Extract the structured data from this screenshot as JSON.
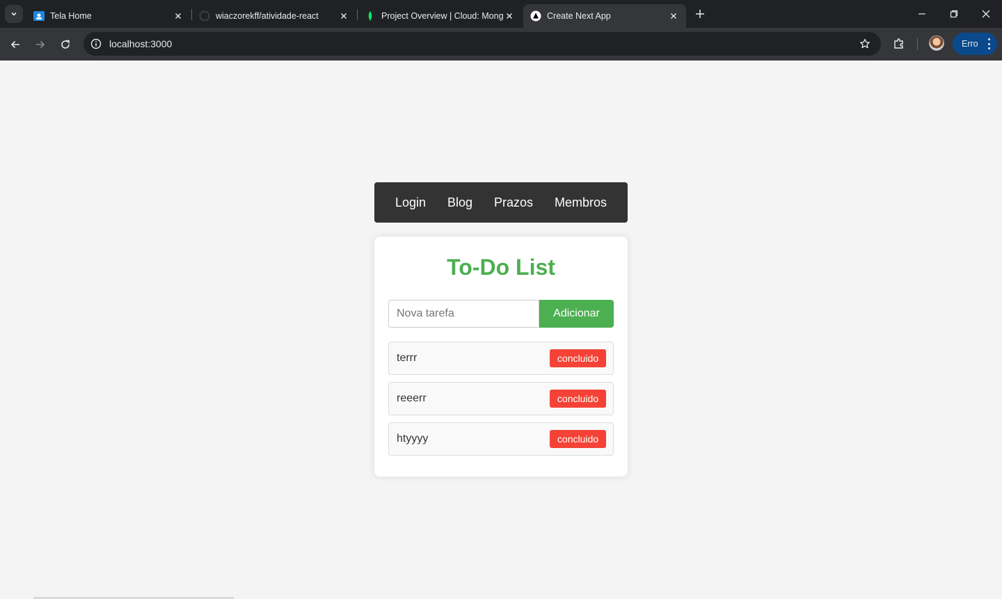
{
  "browser": {
    "tabs": [
      {
        "title": "Tela Home",
        "icon": "google-classroom-icon",
        "active": false
      },
      {
        "title": "wiaczorekff/atividade-react",
        "icon": "github-icon",
        "active": false
      },
      {
        "title": "Project Overview | Cloud: MongoDB Cloud",
        "icon": "mongodb-leaf-icon",
        "active": false
      },
      {
        "title": "Create Next App",
        "icon": "nextjs-triangle-icon",
        "active": true
      }
    ],
    "url": "localhost:3000",
    "profile_button_label": "Erro"
  },
  "nav": {
    "links": [
      "Login",
      "Blog",
      "Prazos",
      "Membros"
    ]
  },
  "todo": {
    "title": "To-Do List",
    "input_placeholder": "Nova tarefa",
    "input_value": "",
    "add_button_label": "Adicionar",
    "tasks": [
      {
        "text": "terrr",
        "button_label": "concluido"
      },
      {
        "text": "reeerr",
        "button_label": "concluido"
      },
      {
        "text": "htyyyy",
        "button_label": "concluido"
      }
    ]
  },
  "colors": {
    "accent_green": "#4caf50",
    "danger_red": "#f44336",
    "navbar_bg": "#333333",
    "page_bg": "#f4f4f4"
  }
}
